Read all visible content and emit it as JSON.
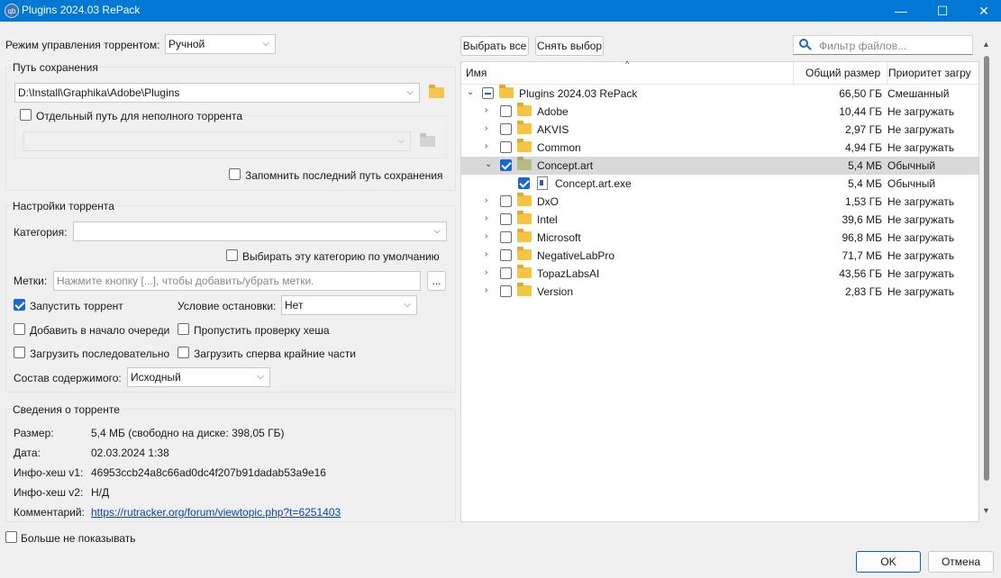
{
  "window": {
    "title": "Plugins 2024.03 RePack",
    "app_icon_text": "qb",
    "min_glyph": "—",
    "max_glyph": "☐",
    "close_glyph": "✕"
  },
  "torrent_mode": {
    "label": "Режим управления торрентом:",
    "value": "Ручной"
  },
  "save_path": {
    "group_title": "Путь сохранения",
    "path": "D:\\Install\\Graphika\\Adobe\\Plugins",
    "separate_path_label": "Отдельный путь для неполного торрента",
    "remember_label": "Запомнить последний путь сохранения"
  },
  "settings": {
    "group_title": "Настройки торрента",
    "category_label": "Категория:",
    "category_value": "",
    "default_category_label": "Выбирать эту категорию по умолчанию",
    "tags_label": "Метки:",
    "tags_placeholder": "Нажмите кнопку [...], чтобы добавить/убрать метки.",
    "tags_button": "...",
    "start_label": "Запустить торрент",
    "stop_condition_label": "Условие остановки:",
    "stop_condition_value": "Нет",
    "add_top_label": "Добавить в начало очереди",
    "skip_hash_label": "Пропустить проверку хеша",
    "sequential_label": "Загрузить последовательно",
    "first_last_label": "Загрузить сперва крайние части",
    "layout_label": "Состав содержимого:",
    "layout_value": "Исходный"
  },
  "info": {
    "group_title": "Сведения о торренте",
    "size_label": "Размер:",
    "size_value": "5,4 МБ (свободно на диске: 398,05 ГБ)",
    "date_label": "Дата:",
    "date_value": "02.03.2024 1:38",
    "hash1_label": "Инфо-хеш v1:",
    "hash1_value": "46953ccb24a8c66ad0dc4f207b91dadab53a9e16",
    "hash2_label": "Инфо-хеш v2:",
    "hash2_value": "Н/Д",
    "comment_label": "Комментарий:",
    "comment_value": "https://rutracker.org/forum/viewtopic.php?t=6251403"
  },
  "dont_show_label": "Больше не показывать",
  "toolbar": {
    "select_all": "Выбрать все",
    "select_none": "Снять выбор",
    "filter_placeholder": "Фильтр файлов..."
  },
  "tree": {
    "columns": {
      "name": "Имя",
      "size": "Общий размер",
      "priority": "Приоритет загру"
    },
    "root": {
      "name": "Plugins 2024.03 RePack",
      "size": "66,50 ГБ",
      "priority": "Смешанный"
    },
    "items": [
      {
        "name": "Adobe",
        "size": "10,44 ГБ",
        "priority": "Не загружать"
      },
      {
        "name": "AKVIS",
        "size": "2,97 ГБ",
        "priority": "Не загружать"
      },
      {
        "name": "Common",
        "size": "4,94 ГБ",
        "priority": "Не загружать"
      },
      {
        "name": "Concept.art",
        "size": "5,4 МБ",
        "priority": "Обычный"
      },
      {
        "name": "Concept.art.exe",
        "size": "5,4 МБ",
        "priority": "Обычный"
      },
      {
        "name": "DxO",
        "size": "1,53 ГБ",
        "priority": "Не загружать"
      },
      {
        "name": "Intel",
        "size": "39,6 МБ",
        "priority": "Не загружать"
      },
      {
        "name": "Microsoft",
        "size": "96,8 МБ",
        "priority": "Не загружать"
      },
      {
        "name": "NegativeLabPro",
        "size": "71,7 МБ",
        "priority": "Не загружать"
      },
      {
        "name": "TopazLabsAI",
        "size": "43,56 ГБ",
        "priority": "Не загружать"
      },
      {
        "name": "Version",
        "size": "2,83 ГБ",
        "priority": "Не загружать"
      }
    ]
  },
  "buttons": {
    "ok": "OK",
    "cancel": "Отмена"
  },
  "glyphs": {
    "chevron_down": "⌵",
    "expanded": "⌄",
    "collapsed": "›",
    "sort_up": "^",
    "scroll_up": "▲",
    "scroll_down": "▼"
  }
}
